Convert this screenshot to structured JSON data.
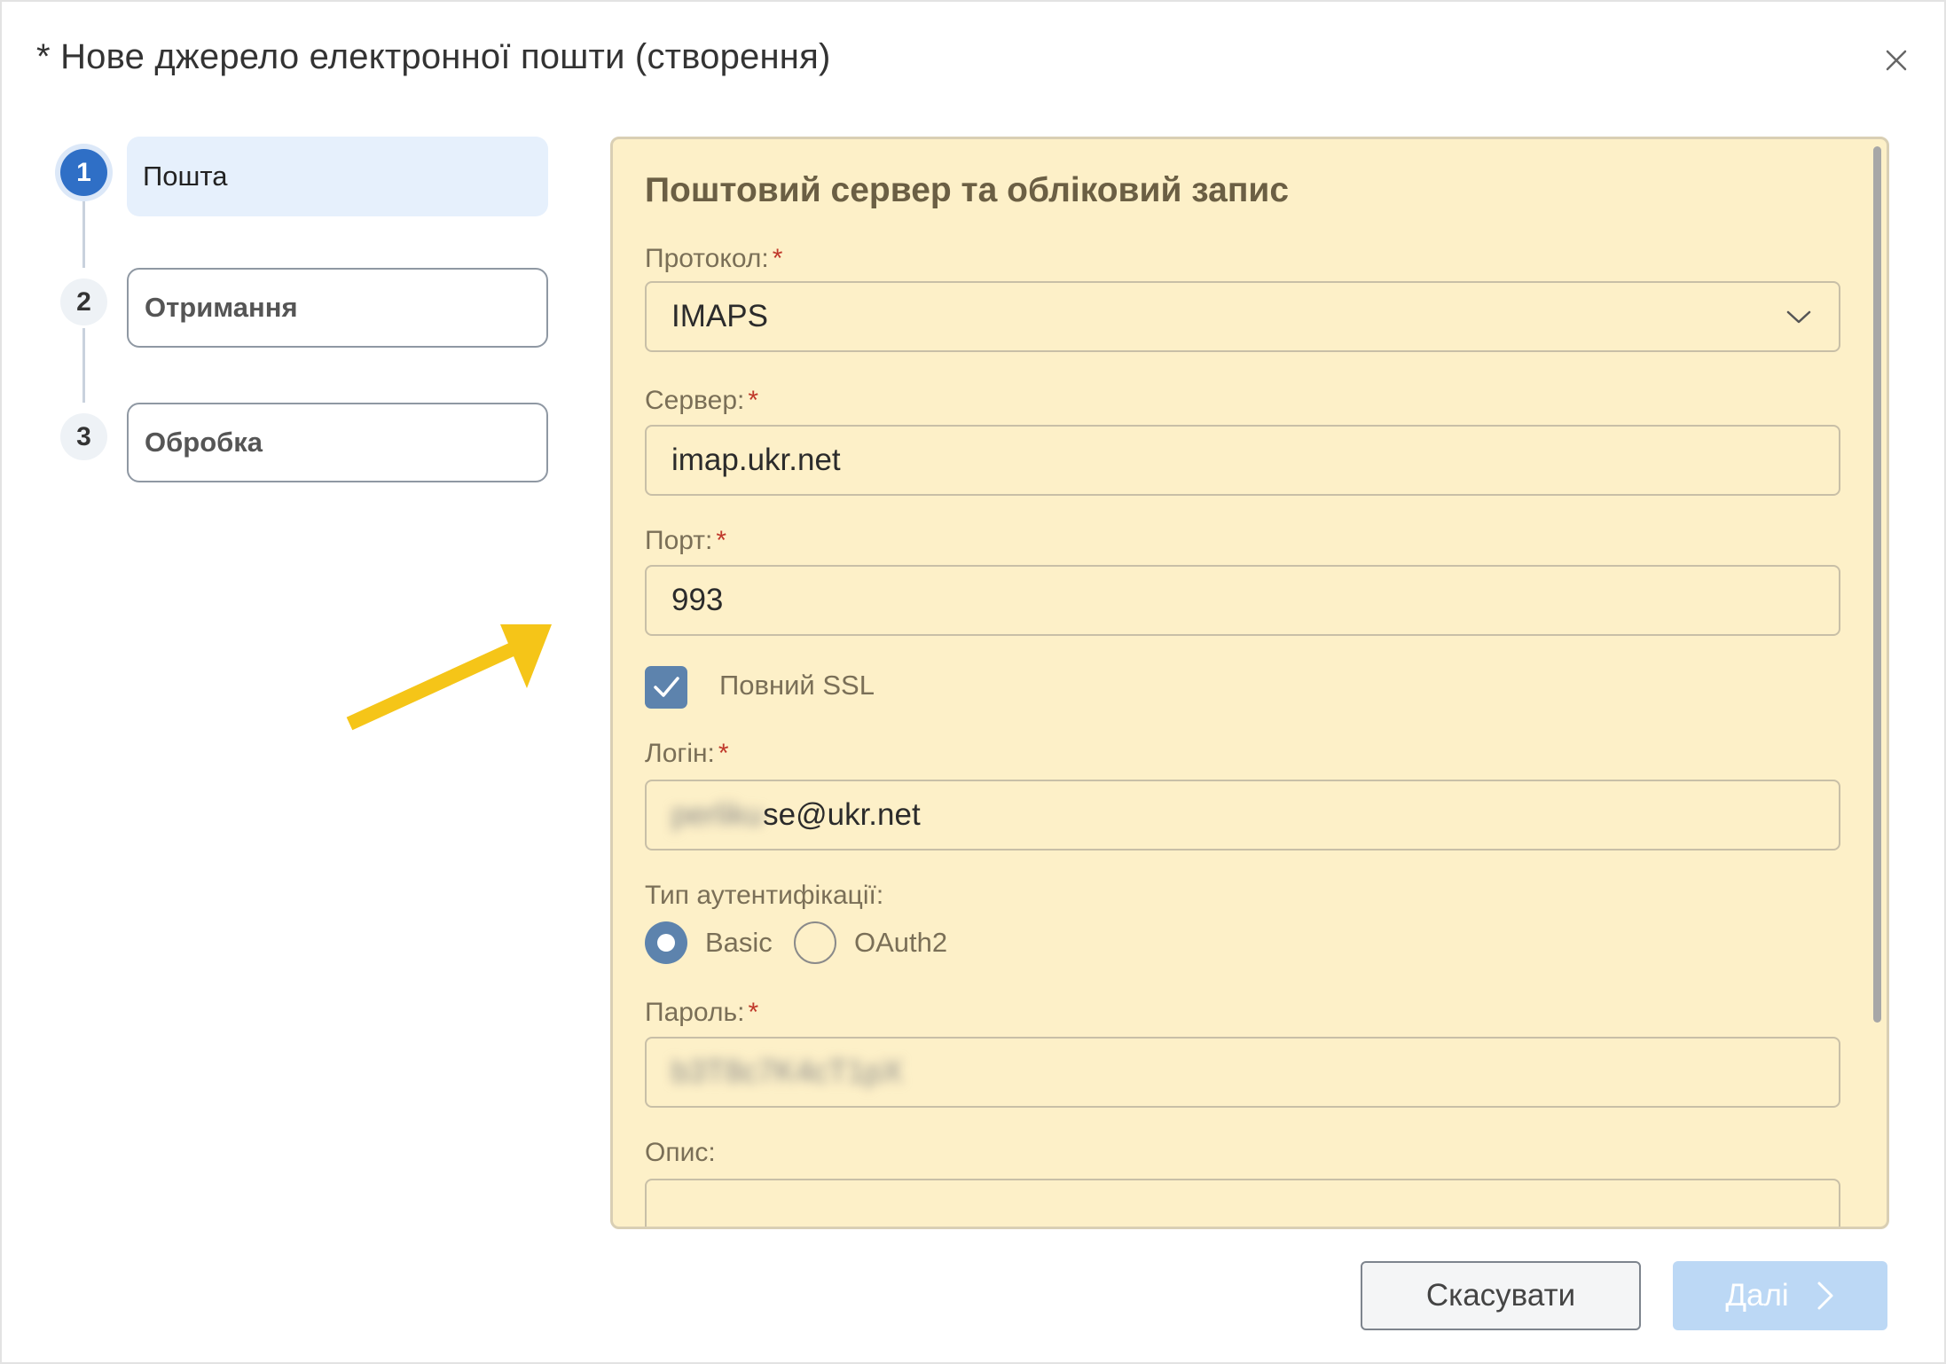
{
  "dialog": {
    "title": "* Нове джерело електронної пошти (створення)"
  },
  "steps": [
    {
      "number": "1",
      "label": "Пошта",
      "state": "active"
    },
    {
      "number": "2",
      "label": "Отримання",
      "state": "idle"
    },
    {
      "number": "3",
      "label": "Обробка",
      "state": "idle"
    }
  ],
  "form": {
    "section_title": "Поштовий сервер та обліковий запис",
    "protocol": {
      "label": "Протокол:",
      "required": "*",
      "value": "IMAPS"
    },
    "server": {
      "label": "Сервер:",
      "required": "*",
      "value": "imap.ukr.net"
    },
    "port": {
      "label": "Порт:",
      "required": "*",
      "value": "993"
    },
    "full_ssl": {
      "label": "Повний SSL",
      "checked": true
    },
    "login": {
      "label": "Логін:",
      "required": "*",
      "value_hidden": "perliku",
      "value": "se@ukr.net"
    },
    "auth_type": {
      "label": "Тип аутентифікації:",
      "options": [
        {
          "label": "Basic",
          "selected": true
        },
        {
          "label": "OAuth2",
          "selected": false
        }
      ]
    },
    "password": {
      "label": "Пароль:",
      "required": "*",
      "value_hidden": "b3T8c7K4cT1pX"
    },
    "description": {
      "label": "Опис:",
      "value": ""
    }
  },
  "footer": {
    "cancel_label": "Скасувати",
    "next_label": "Далі"
  },
  "colors": {
    "accent": "#2f6fc6",
    "panel_bg": "#fdf0c8",
    "arrow": "#f5c518",
    "required": "#c0392b"
  }
}
